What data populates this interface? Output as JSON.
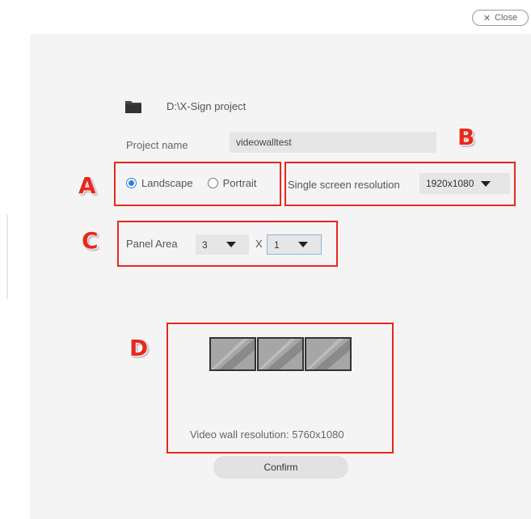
{
  "close_button": {
    "label": "Close"
  },
  "project": {
    "path": "D:\\X-Sign project",
    "name_label": "Project name",
    "name_value": "videowalltest"
  },
  "orientation": {
    "options": [
      {
        "label": "Landscape",
        "selected": true
      },
      {
        "label": "Portrait",
        "selected": false
      }
    ]
  },
  "resolution": {
    "label": "Single screen resolution",
    "value": "1920x1080"
  },
  "panel_area": {
    "label": "Panel Area",
    "columns": "3",
    "separator": "X",
    "rows": "1"
  },
  "preview": {
    "screen_count": 3,
    "wall_resolution_text": "Video wall resolution: 5760x1080"
  },
  "confirm_button": {
    "label": "Confirm"
  },
  "callouts": [
    "A",
    "B",
    "C",
    "D"
  ],
  "colors": {
    "callout_red": "#e8281d",
    "radio_blue": "#2f80d8",
    "panel_bg": "#f4f4f4",
    "input_bg": "#e6e6e6"
  }
}
